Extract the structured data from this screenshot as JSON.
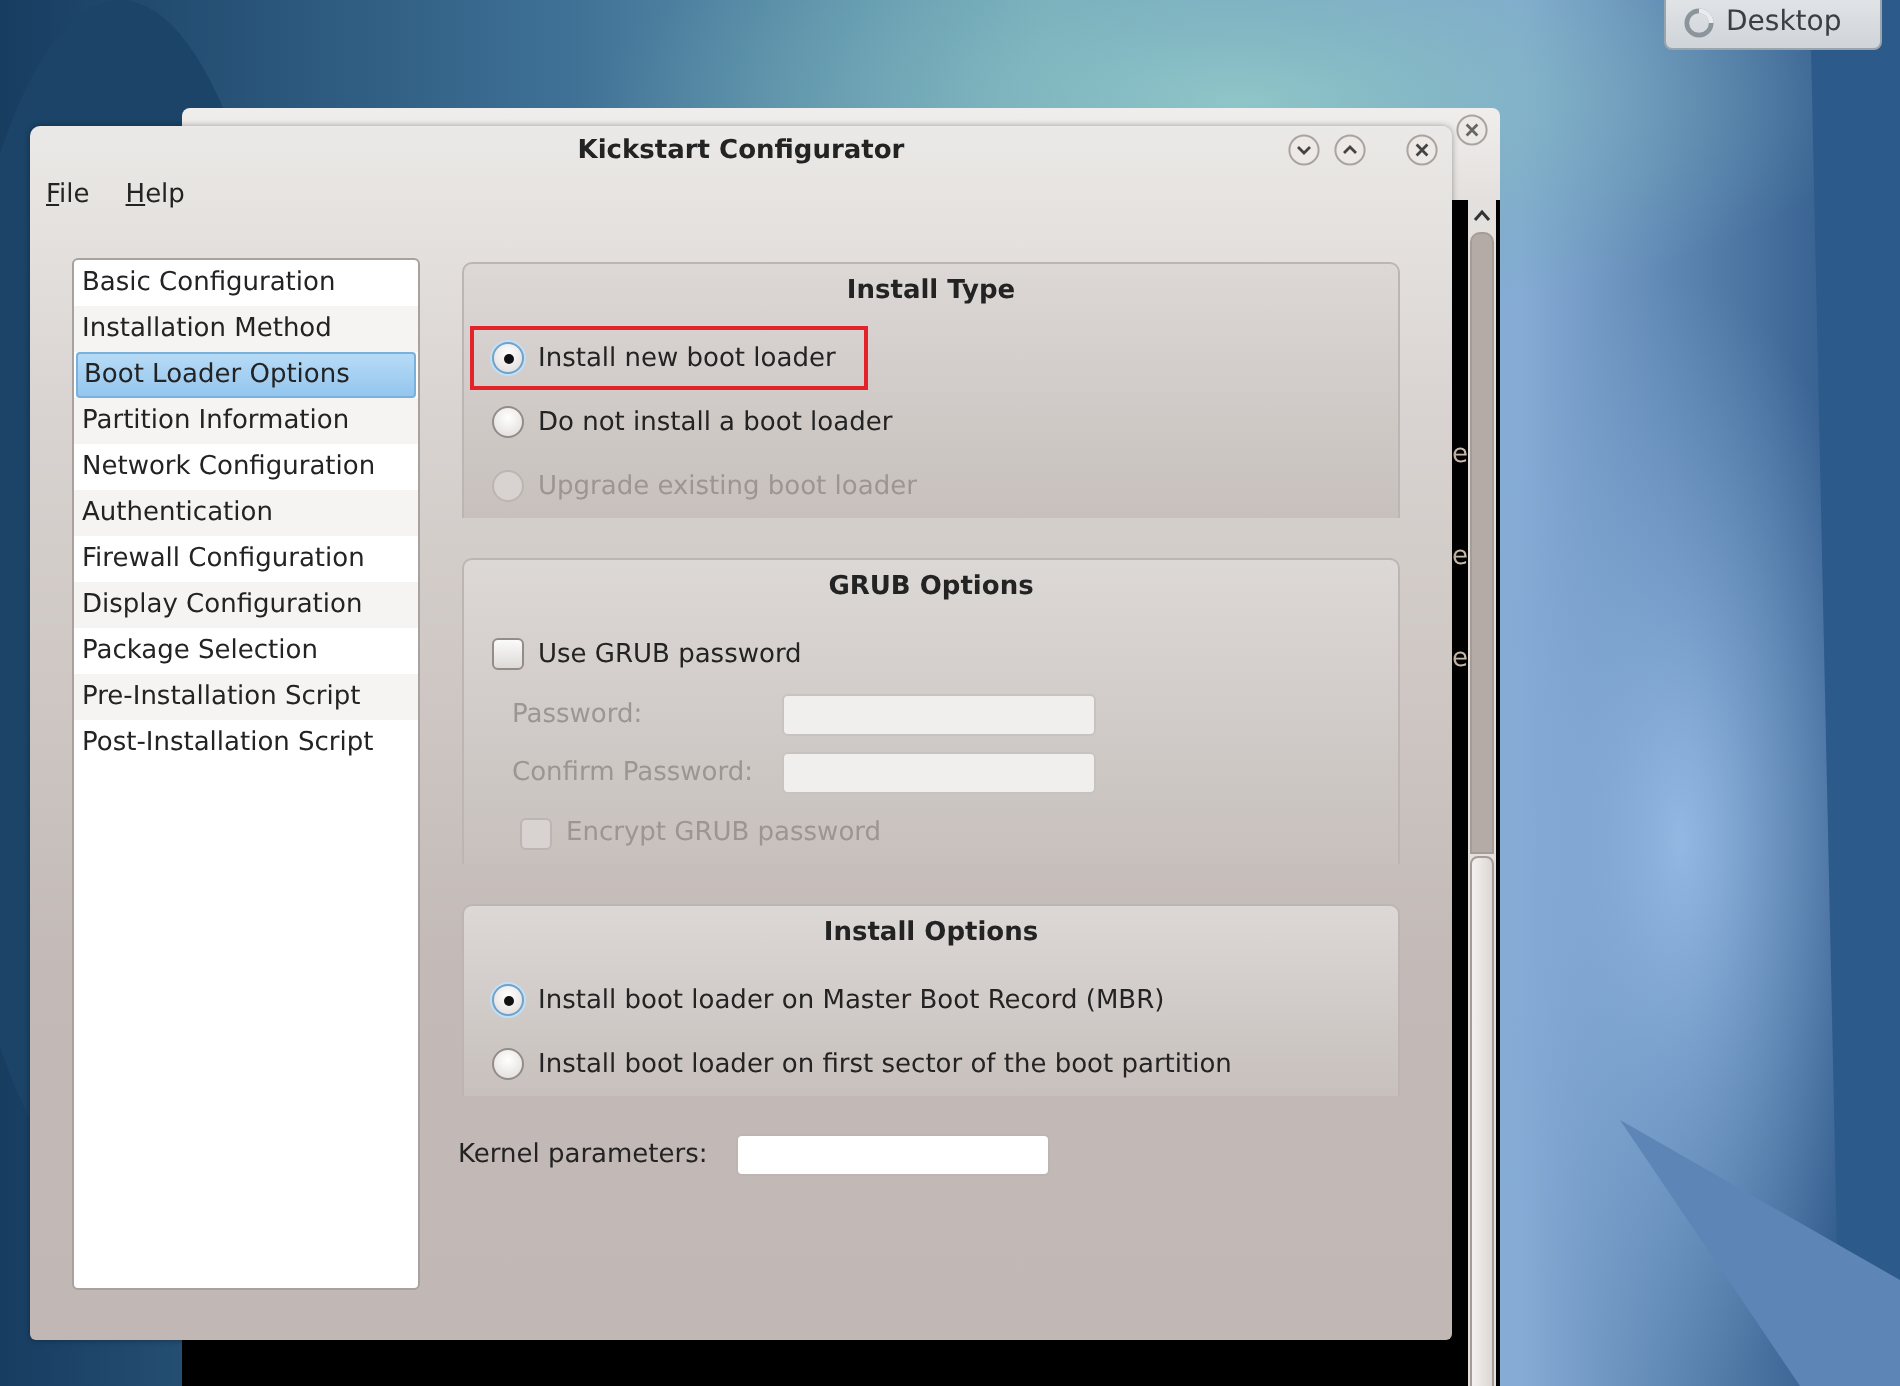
{
  "desktop": {
    "panel_button": {
      "label": "Desktop"
    }
  },
  "konsole": {
    "text_lines": [
      "e",
      "e",
      "e"
    ]
  },
  "window": {
    "title": "Kickstart Configurator"
  },
  "menu": [
    {
      "label": "File"
    },
    {
      "label": "Help"
    }
  ],
  "sidebar": {
    "items": [
      {
        "label": "Basic Configuration",
        "selected": false
      },
      {
        "label": "Installation Method",
        "selected": false
      },
      {
        "label": "Boot Loader Options",
        "selected": true
      },
      {
        "label": "Partition Information",
        "selected": false
      },
      {
        "label": "Network Configuration",
        "selected": false
      },
      {
        "label": "Authentication",
        "selected": false
      },
      {
        "label": "Firewall Configuration",
        "selected": false
      },
      {
        "label": "Display Configuration",
        "selected": false
      },
      {
        "label": "Package Selection",
        "selected": false
      },
      {
        "label": "Pre-Installation Script",
        "selected": false
      },
      {
        "label": "Post-Installation Script",
        "selected": false
      }
    ]
  },
  "groups": [
    {
      "title": "Install Type",
      "items": [
        {
          "kind": "radio",
          "label": "Install new boot loader",
          "selected": true,
          "disabled": false,
          "highlighted": true
        },
        {
          "kind": "radio",
          "label": "Do not install a boot loader",
          "selected": false,
          "disabled": false,
          "highlighted": false
        },
        {
          "kind": "radio",
          "label": "Upgrade existing boot loader",
          "selected": false,
          "disabled": true,
          "highlighted": false
        }
      ]
    },
    {
      "title": "GRUB Options",
      "items": [
        {
          "kind": "checkbox",
          "label": "Use GRUB password",
          "checked": false,
          "disabled": false
        },
        {
          "kind": "field",
          "label": "Password:",
          "disabled": true
        },
        {
          "kind": "field",
          "label": "Confirm Password:",
          "disabled": true
        },
        {
          "kind": "checkbox",
          "label": "Encrypt GRUB password",
          "checked": false,
          "disabled": true
        }
      ]
    },
    {
      "title": "Install Options",
      "items": [
        {
          "kind": "radio",
          "label": "Install boot loader on Master Boot Record (MBR)",
          "selected": true,
          "disabled": false,
          "highlighted": false
        },
        {
          "kind": "radio",
          "label": "Install boot loader on first sector of the boot partition",
          "selected": false,
          "disabled": false,
          "highlighted": false
        }
      ]
    }
  ],
  "kernel": {
    "label": "Kernel parameters:"
  }
}
